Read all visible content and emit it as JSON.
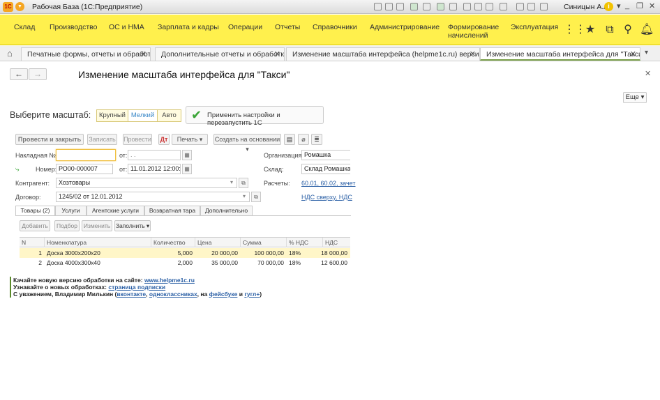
{
  "titlebar": {
    "title": "Рабочая База  (1С:Предприятие)",
    "user": "Синицын А.А.",
    "logo": "1С"
  },
  "main_menu": [
    "Склад",
    "Производство",
    "ОС и НМА",
    "Зарплата и кадры",
    "Операции",
    "Отчеты",
    "Справочники",
    "Администрирование",
    "Формирование начислений",
    "Эксплуатация"
  ],
  "open_tabs": [
    "Печатные формы, отчеты и обработки",
    "Дополнительные отчеты и обработки",
    "Изменение масштаба интерфейса (helpme1c.ru) верси...",
    "Изменение масштаба интерфейса для \"Такси\""
  ],
  "form": {
    "title": "Изменение масштаба интерфейса для \"Такси\"",
    "more_label": "Еще",
    "scale_label": "Выберите масштаб:",
    "scale_options": [
      "Крупный",
      "Мелкий",
      "Авто"
    ],
    "apply_label": "Применить настройки и перезапустить 1С"
  },
  "preview": {
    "toolbar": {
      "post_close": "Провести и закрыть",
      "save": "Записать",
      "post": "Провести",
      "print": "Печать",
      "create_based": "Создать на основании"
    },
    "invoice_label": "Накладная №:",
    "invoice_value": "",
    "from_label": "от:",
    "from_value": ". .",
    "number_label": "Номер:",
    "number_value": "РО00-000007",
    "from2_label": "от:",
    "from2_value": "11.01.2012 12:00:00",
    "org_label": "Организация:",
    "org_value": "Ромашка",
    "warehouse_label": "Склад:",
    "warehouse_value": "Склад Ромашка",
    "counterparty_label": "Контрагент:",
    "counterparty_value": "Хозтовары",
    "settlements_label": "Расчеты:",
    "settlements_value": "60.01, 60.02, зачет",
    "contract_label": "Договор:",
    "contract_value": "1245/02 от 12.01.2012",
    "vat_link": "НДС сверху, НДС",
    "tabs": [
      "Товары (2)",
      "Услуги",
      "Агентские услуги",
      "Возвратная тара",
      "Дополнительно"
    ],
    "table_buttons": [
      "Добавить",
      "Подбор",
      "Изменить",
      "Заполнить"
    ],
    "columns": [
      "N",
      "Номенклатура",
      "Количество",
      "Цена",
      "Сумма",
      "% НДС",
      "НДС"
    ],
    "rows": [
      [
        "1",
        "Доска 3000х200х20",
        "5,000",
        "20 000,00",
        "100 000,00",
        "18%",
        "18 000,00"
      ],
      [
        "2",
        "Доска 4000х300х40",
        "2,000",
        "35 000,00",
        "70 000,00",
        "18%",
        "12 600,00"
      ]
    ]
  },
  "footer": {
    "line1_text": "Качайте новую версию обработки на сайте: ",
    "line1_link": "www.helpme1c.ru",
    "line2_text": "Узнавайте о новых обработках: ",
    "line2_link": "страница подписки",
    "line3_text": "С уважением, Владимир Милькин (",
    "link_vk": "вконтакте",
    "sep1": ", ",
    "link_ok": "одноклассниках",
    "sep2": ", на ",
    "link_fb": "фейсбуке",
    "sep3": " и ",
    "link_gplus": "гугл+",
    "line3_end": ")"
  }
}
